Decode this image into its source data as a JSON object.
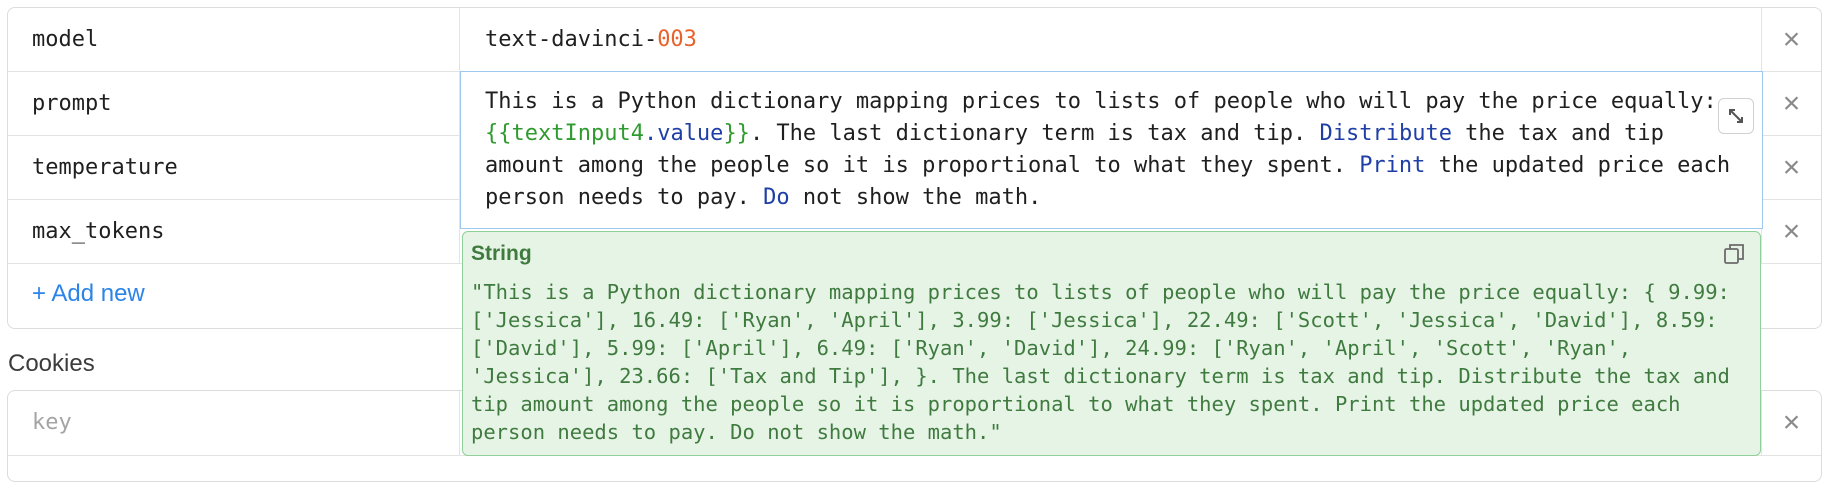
{
  "params": {
    "rows": [
      {
        "key": "model",
        "value_prefix": "text-davinci-",
        "value_number": "003"
      },
      {
        "key": "prompt"
      },
      {
        "key": "temperature"
      },
      {
        "key": "max_tokens"
      }
    ],
    "add_new_label": "+ Add new"
  },
  "editor": {
    "p1": "This is a Python dictionary mapping prices to lists of people who will pay the price equally: ",
    "tpl_open": "{{textInput4",
    "tpl_dot": ".value",
    "tpl_close": "}}",
    "p2": ". The last dictionary term is tax and tip. ",
    "kw1": "Distribute",
    "p3": " the tax and tip amount among the people so it is proportional to what they spent. ",
    "kw2": "Print",
    "p4": " the updated price each person needs to pay. ",
    "kw3": "Do",
    "p5": " not show the math."
  },
  "preview": {
    "type_label": "String",
    "text": "\"This is a Python dictionary mapping prices to lists of people who will pay the price equally: { 9.99: ['Jessica'], 16.49: ['Ryan', 'April'], 3.99: ['Jessica'], 22.49: ['Scott', 'Jessica', 'David'], 8.59: ['David'], 5.99: ['April'], 6.49: ['Ryan', 'David'], 24.99: ['Ryan', 'April', 'Scott', 'Ryan', 'Jessica'], 23.66: ['Tax and Tip'], }. The last dictionary term is tax and tip. Distribute the tax and tip amount among the people so it is proportional to what they spent. Print the updated price each person needs to pay. Do not show the math.\""
  },
  "cookies": {
    "heading": "Cookies",
    "key_placeholder": "key"
  },
  "icons": {
    "delete": "close-icon",
    "expand": "expand-icon",
    "copy": "copy-icon"
  },
  "colors": {
    "accent": "#2c84e8",
    "number": "#e8622c",
    "template": "#2f9b2f",
    "keyword": "#1f3fa6",
    "preview_bg": "#e6f4e6",
    "preview_text": "#3f7a3f"
  }
}
